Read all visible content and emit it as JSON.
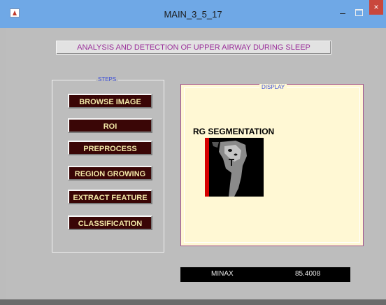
{
  "window": {
    "title": "MAIN_3_5_17",
    "minimize_label": "–",
    "close_label": "×"
  },
  "header": {
    "text": "ANALYSIS AND DETECTION OF UPPER AIRWAY DURING SLEEP"
  },
  "steps": {
    "title": "STEPS",
    "buttons": [
      {
        "label": "BROWSE IMAGE"
      },
      {
        "label": "ROI"
      },
      {
        "label": "PREPROCESS"
      },
      {
        "label": "REGION GROWING"
      },
      {
        "label": "EXTRACT FEATURE"
      },
      {
        "label": "CLASSIFICATION"
      }
    ]
  },
  "display": {
    "title": "DISPLAY",
    "image_title": "RG SEGMENTATION"
  },
  "readout": {
    "label": "MINAX",
    "value": "85.4008"
  },
  "colors": {
    "titlebar": "#6fa8e6",
    "background": "#bdbdbd",
    "button_bg": "#3a0606",
    "button_text": "#f2e7a6",
    "header_text": "#9a2f9a",
    "panel_title": "#3b4ed8",
    "display_bg": "#fff8d4"
  },
  "icons": {
    "app": "matlab-figure-icon"
  }
}
